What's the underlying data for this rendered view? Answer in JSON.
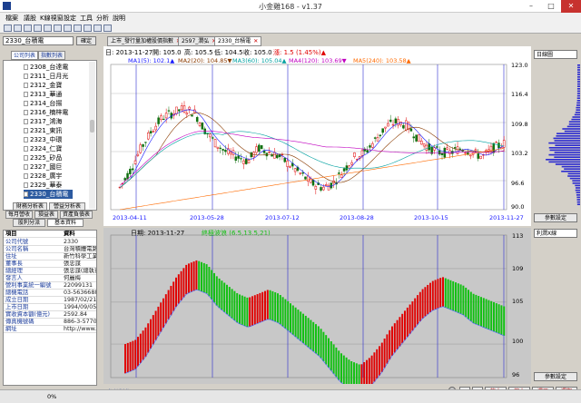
{
  "window": {
    "title": "小金雞168 - v1.37",
    "minimize": "–",
    "maximize": "□",
    "close": "✕"
  },
  "menu": [
    "檔案",
    "議股",
    "K線視窗",
    "設定",
    "工具",
    "分析",
    "說明"
  ],
  "search": {
    "value": "2330_台積電",
    "ok_label": "確定"
  },
  "left_tabs": [
    "公司列表",
    "指數列表"
  ],
  "stock_list": [
    "2308_台達電",
    "2311_日月光",
    "2312_金寶",
    "2313_華通",
    "2314_台揚",
    "2316_楠梓電",
    "2317_鴻海",
    "2321_東訊",
    "2323_中環",
    "2324_仁寶",
    "2325_矽品",
    "2327_國巨",
    "2328_廣宇",
    "2329_華泰",
    "2330_台積電"
  ],
  "selected_stock": "2330_台積電",
  "bottom_tabs": [
    "財務分析表",
    "營益分析表",
    "每月營收",
    "損益表",
    "資產負債表",
    "股利分派",
    "基本資料"
  ],
  "info": {
    "header": {
      "k": "項目",
      "v": "資料"
    },
    "rows": [
      {
        "k": "公司代號",
        "v": "2330"
      },
      {
        "k": "公司名稱",
        "v": "台灣積體電路"
      },
      {
        "k": "住址",
        "v": "新竹科學工業"
      },
      {
        "k": "董事長",
        "v": "張忠謀"
      },
      {
        "k": "總經理",
        "v": "張忠謀(總執行"
      },
      {
        "k": "發言人",
        "v": "何麗梅"
      },
      {
        "k": "營利事業統一編號",
        "v": "22099131"
      },
      {
        "k": "總機電話",
        "v": "03-5636688"
      },
      {
        "k": "成立日期",
        "v": "1987/02/21"
      },
      {
        "k": "上市日期",
        "v": "1994/09/05"
      },
      {
        "k": "實收資本額(億元)",
        "v": "2592.84"
      },
      {
        "k": "傳真機號碼",
        "v": "886-3-5770089"
      },
      {
        "k": "網址",
        "v": "http://www.tsm"
      }
    ]
  },
  "status": {
    "progress": "0%"
  },
  "doc_tabs": [
    "上市_發行量加權股價指數",
    "2597_潤弘",
    "2330_台積電"
  ],
  "header_line": {
    "date": "日: 2013-11-27",
    "open": "開: 105.0",
    "high": "高: 105.5",
    "low": "低: 104.5",
    "close": "收: 105.0",
    "change": "漲: 1.5 (1.45%)▲"
  },
  "ma_line": [
    {
      "text": "MA1(5): 102.1▲",
      "color": "#1a1aff"
    },
    {
      "text": "MA2(20): 104.85▼",
      "color": "#8a3b00"
    },
    {
      "text": "MA3(60): 105.04▲",
      "color": "#00a0a0"
    },
    {
      "text": "MA4(120): 103.69▼",
      "color": "#c000c0"
    },
    {
      "text": "MA5(240): 103.58▲",
      "color": "#ff6a00"
    }
  ],
  "upper_chart": {
    "ylim": [
      90,
      123
    ],
    "yticks": [
      "123.0",
      "116.4",
      "109.8",
      "103.2",
      "96.6",
      "90.0"
    ],
    "xlabels": [
      "2013-04-11",
      "2013-05-28",
      "2013-07-12",
      "2013-08-28",
      "2013-10-15",
      "2013-11-27"
    ]
  },
  "lower_chart": {
    "header_date": "日期: 2013-11-27",
    "indicator_label": "終極波浪 (6.5,13.5,21)",
    "ylim": [
      96,
      113
    ],
    "yticks": [
      "113",
      "109",
      "105",
      "100",
      "96"
    ]
  },
  "right_panel": {
    "select_top": "日線圖",
    "btn_top": "參數設定",
    "select_bottom": "利潤Ⅹ線",
    "btn_bottom": "參數設定"
  },
  "bottom_bar": {
    "label": "參數製作用",
    "buttons": [
      "<",
      ">",
      "放大",
      "縮小",
      "還原",
      "週期"
    ]
  },
  "colors": {
    "up": "#e00000",
    "down": "#10c010",
    "accent": "#1b3f8f"
  },
  "chart_data": [
    {
      "type": "candlestick",
      "title": "",
      "ylim": [
        90,
        123
      ],
      "x": [
        "2013-04-11",
        "2013-05-28",
        "2013-07-12",
        "2013-08-28",
        "2013-10-15",
        "2013-11-27"
      ],
      "close": [
        95.0,
        111.0,
        103.0,
        97.5,
        110.0,
        105.0
      ],
      "series": [
        {
          "values": [
            95,
            99,
            104,
            108,
            111,
            112,
            113,
            112,
            108,
            105,
            103,
            102,
            101,
            104,
            103,
            102,
            100,
            98,
            96,
            95,
            96,
            99,
            102,
            103,
            106,
            109,
            110,
            109,
            106,
            104,
            103,
            103,
            104,
            103,
            102,
            104,
            105
          ]
        }
      ]
    },
    {
      "type": "bar",
      "title": "",
      "ylim": [
        96,
        113
      ],
      "series": [
        {
          "values": [
            100,
            100.5,
            102,
            104,
            106,
            108,
            109.5,
            110,
            109.5,
            108,
            107,
            106,
            105.5,
            106,
            106.5,
            106,
            105,
            104,
            103,
            102,
            100.5,
            99,
            98,
            97.5,
            98.5,
            100,
            102,
            103.5,
            105,
            106.5,
            107.5,
            108,
            107.5,
            107,
            106,
            105.5,
            105,
            104.5
          ]
        }
      ]
    }
  ]
}
